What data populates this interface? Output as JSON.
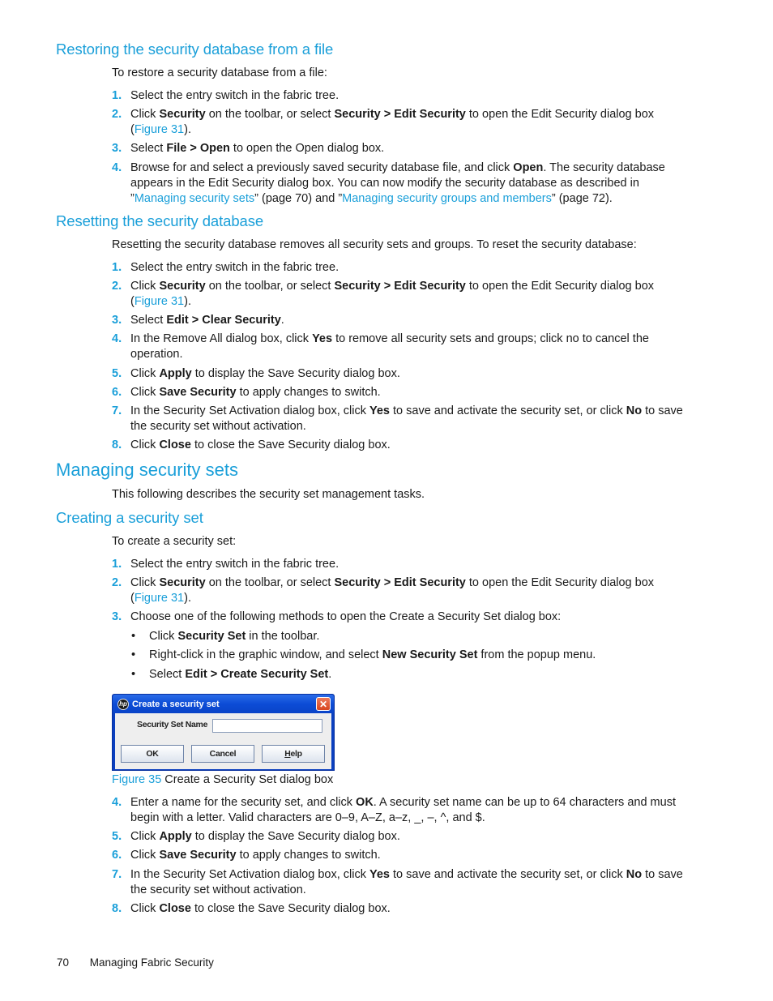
{
  "sections": {
    "restore": {
      "heading": "Restoring the security database from a file",
      "intro": "To restore a security database from a file:",
      "steps": [
        {
          "num": "1.",
          "parts": [
            {
              "t": "Select the entry switch in the fabric tree."
            }
          ]
        },
        {
          "num": "2.",
          "parts": [
            {
              "t": "Click "
            },
            {
              "b": "Security"
            },
            {
              "t": " on the toolbar, or select "
            },
            {
              "b": "Security > Edit Security"
            },
            {
              "t": " to open the Edit Security dialog box ("
            },
            {
              "l": "Figure 31"
            },
            {
              "t": ")."
            }
          ]
        },
        {
          "num": "3.",
          "parts": [
            {
              "t": "Select "
            },
            {
              "b": "File > Open"
            },
            {
              "t": " to open the Open dialog box."
            }
          ]
        },
        {
          "num": "4.",
          "parts": [
            {
              "t": "Browse for and select a previously saved security database file, and click "
            },
            {
              "b": "Open"
            },
            {
              "t": ". The security database appears in the Edit Security dialog box. You can now modify the security database as described in ”"
            },
            {
              "l": "Managing security sets"
            },
            {
              "t": "” (page 70) and ”"
            },
            {
              "l": "Managing security groups and members"
            },
            {
              "t": "” (page 72)."
            }
          ]
        }
      ]
    },
    "reset": {
      "heading": "Resetting the security database",
      "intro": "Resetting the security database removes all security sets and groups. To reset the security database:",
      "steps": [
        {
          "num": "1.",
          "parts": [
            {
              "t": "Select the entry switch in the fabric tree."
            }
          ]
        },
        {
          "num": "2.",
          "parts": [
            {
              "t": "Click "
            },
            {
              "b": "Security"
            },
            {
              "t": " on the toolbar, or select "
            },
            {
              "b": "Security > Edit Security"
            },
            {
              "t": " to open the Edit Security dialog box ("
            },
            {
              "l": "Figure 31"
            },
            {
              "t": ")."
            }
          ]
        },
        {
          "num": "3.",
          "parts": [
            {
              "t": "Select "
            },
            {
              "b": "Edit > Clear Security"
            },
            {
              "t": "."
            }
          ]
        },
        {
          "num": "4.",
          "parts": [
            {
              "t": "In the Remove All dialog box, click "
            },
            {
              "b": "Yes"
            },
            {
              "t": " to remove all security sets and groups; click no to cancel the operation."
            }
          ]
        },
        {
          "num": "5.",
          "parts": [
            {
              "t": "Click "
            },
            {
              "b": "Apply"
            },
            {
              "t": " to display the Save Security dialog box."
            }
          ]
        },
        {
          "num": "6.",
          "parts": [
            {
              "t": "Click "
            },
            {
              "b": "Save Security"
            },
            {
              "t": " to apply changes to switch."
            }
          ]
        },
        {
          "num": "7.",
          "parts": [
            {
              "t": "In the Security Set Activation dialog box, click "
            },
            {
              "b": "Yes"
            },
            {
              "t": " to save and activate the security set, or click "
            },
            {
              "b": "No"
            },
            {
              "t": " to save the security set without activation."
            }
          ]
        },
        {
          "num": "8.",
          "parts": [
            {
              "t": "Click "
            },
            {
              "b": "Close"
            },
            {
              "t": " to close the Save Security dialog box."
            }
          ]
        }
      ]
    },
    "managing": {
      "heading": "Managing security sets",
      "intro": "This following describes the security set management tasks."
    },
    "create": {
      "heading": "Creating a security set",
      "intro": "To create a security set:",
      "steps_a": [
        {
          "num": "1.",
          "parts": [
            {
              "t": "Select the entry switch in the fabric tree."
            }
          ]
        },
        {
          "num": "2.",
          "parts": [
            {
              "t": "Click "
            },
            {
              "b": "Security"
            },
            {
              "t": " on the toolbar, or select "
            },
            {
              "b": "Security > Edit Security"
            },
            {
              "t": " to open the Edit Security dialog box ("
            },
            {
              "l": "Figure 31"
            },
            {
              "t": ")."
            }
          ]
        },
        {
          "num": "3.",
          "parts": [
            {
              "t": "Choose one of the following methods to open the Create a Security Set dialog box:"
            }
          ]
        }
      ],
      "bullets": [
        {
          "parts": [
            {
              "t": "Click "
            },
            {
              "b": "Security Set"
            },
            {
              "t": " in the toolbar."
            }
          ]
        },
        {
          "parts": [
            {
              "t": "Right-click in the graphic window, and select "
            },
            {
              "b": "New Security Set"
            },
            {
              "t": " from the popup menu."
            }
          ]
        },
        {
          "parts": [
            {
              "t": "Select "
            },
            {
              "b": "Edit > Create Security Set"
            },
            {
              "t": "."
            }
          ]
        }
      ],
      "steps_b": [
        {
          "num": "4.",
          "parts": [
            {
              "t": "Enter a name for the security set, and click "
            },
            {
              "b": "OK"
            },
            {
              "t": ". A security set name can be up to 64 characters and must begin with a letter. Valid characters are 0–9, A–Z, a–z, _, –, ^, and $."
            }
          ]
        },
        {
          "num": "5.",
          "parts": [
            {
              "t": "Click "
            },
            {
              "b": "Apply"
            },
            {
              "t": " to display the Save Security dialog box."
            }
          ]
        },
        {
          "num": "6.",
          "parts": [
            {
              "t": "Click "
            },
            {
              "b": "Save Security"
            },
            {
              "t": " to apply changes to switch."
            }
          ]
        },
        {
          "num": "7.",
          "parts": [
            {
              "t": "In the Security Set Activation dialog box, click "
            },
            {
              "b": "Yes"
            },
            {
              "t": " to save and activate the security set, or click "
            },
            {
              "b": "No"
            },
            {
              "t": " to save the security set without activation."
            }
          ]
        },
        {
          "num": "8.",
          "parts": [
            {
              "t": "Click "
            },
            {
              "b": "Close"
            },
            {
              "t": " to close the Save Security dialog box."
            }
          ]
        }
      ]
    }
  },
  "figure": {
    "label": "Figure 35",
    "caption": "Create a Security Set dialog box",
    "dialog": {
      "logo": "hp",
      "title": "Create a security set",
      "close_glyph": "✕",
      "field_label": "Security Set Name",
      "field_value": "",
      "ok": "OK",
      "cancel": "Cancel",
      "help_underlined": "H",
      "help_rest": "elp"
    }
  },
  "footer": {
    "page_number": "70",
    "chapter": "Managing Fabric Security"
  },
  "colors": {
    "accent": "#1a9fd9",
    "text": "#1a1a1a"
  }
}
